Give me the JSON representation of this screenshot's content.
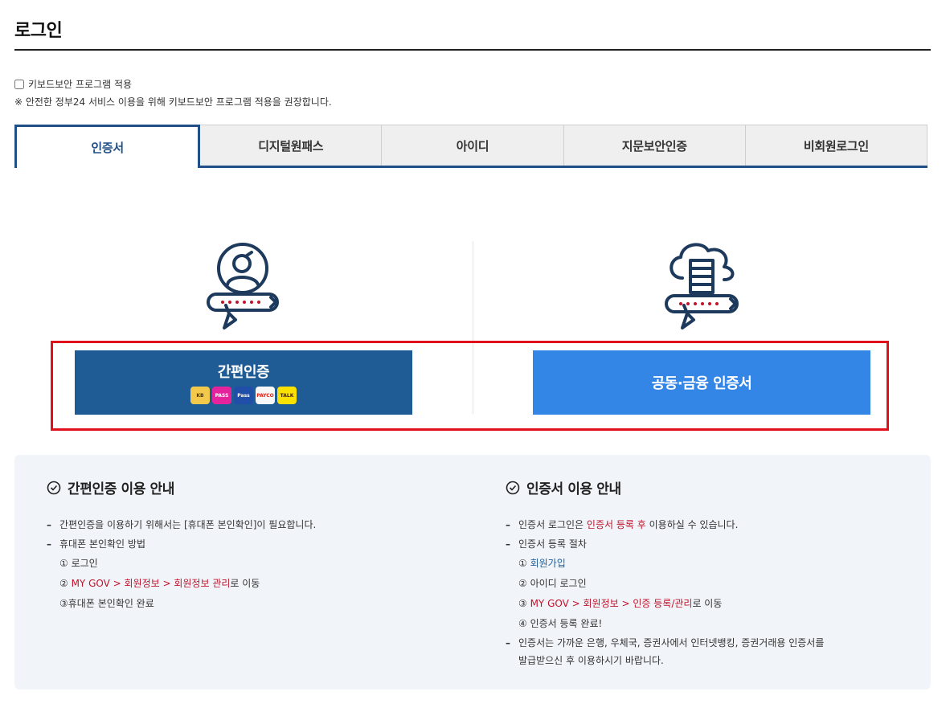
{
  "page": {
    "title": "로그인"
  },
  "keyboard": {
    "checkbox_label": "키보드보안 프로그램 적용",
    "note": "※ 안전한 정부24 서비스 이용을 위해 키보드보안 프로그램 적용을 권장합니다."
  },
  "tabs": [
    {
      "label": "인증서",
      "active": true
    },
    {
      "label": "디지털원패스",
      "active": false
    },
    {
      "label": "아이디",
      "active": false
    },
    {
      "label": "지문보안인증",
      "active": false
    },
    {
      "label": "비회원로그인",
      "active": false
    }
  ],
  "buttons": {
    "simple_auth": "간편인증",
    "joint_cert": "공동·금융 인증서"
  },
  "badges": [
    {
      "name": "kb-badge",
      "text": "KB",
      "bg": "#f4c84b",
      "fg": "#4a3a10"
    },
    {
      "name": "pass-badge",
      "text": "PASS",
      "bg": "#e5239c",
      "fg": "#ffffff"
    },
    {
      "name": "samsung-pass-badge",
      "text": "Pass",
      "bg": "#1f4fa8",
      "fg": "#ffffff"
    },
    {
      "name": "payco-badge",
      "text": "PAYCO",
      "bg": "#f7f7f7",
      "fg": "#e2231a"
    },
    {
      "name": "kakao-talk-badge",
      "text": "TALK",
      "bg": "#fae100",
      "fg": "#3a1d1d"
    }
  ],
  "guide_left": {
    "title": "간편인증 이용 안내",
    "item1": "간편인증을 이용하기 위해서는 [휴대폰 본인확인]이 필요합니다.",
    "item2": "휴대폰 본인확인 방법",
    "step1": "① 로그인",
    "step2_prefix": "② ",
    "step2_link": "MY GOV > 회원정보 > 회원정보 관리",
    "step2_suffix": "로 이동",
    "step3": "③휴대폰 본인확인 완료"
  },
  "guide_right": {
    "title": "인증서 이용 안내",
    "item1_prefix": "인증서 로그인은 ",
    "item1_highlight": "인증서 등록 후",
    "item1_suffix": " 이용하실 수 있습니다.",
    "item2": "인증서 등록 절차",
    "step1_prefix": "① ",
    "step1_link": "회원가입",
    "step2": "② 아이디 로그인",
    "step3_prefix": "③ ",
    "step3_link": "MY GOV > 회원정보 > 인증 등록/관리",
    "step3_suffix": "로 이동",
    "step4": "④ 인증서 등록 완료!",
    "item3_line1": "인증서는 가까운 은행, 우체국, 증권사에서 인터넷뱅킹, 증권거래용 인증서를",
    "item3_line2": "발급받으신 후 이용하시기 바랍니다."
  },
  "colors": {
    "primary": "#1f5c96",
    "secondary_button": "#3385e6",
    "highlight_border": "#e0101d",
    "accent_red": "#c0132b",
    "icon": "#1d3a5c"
  }
}
